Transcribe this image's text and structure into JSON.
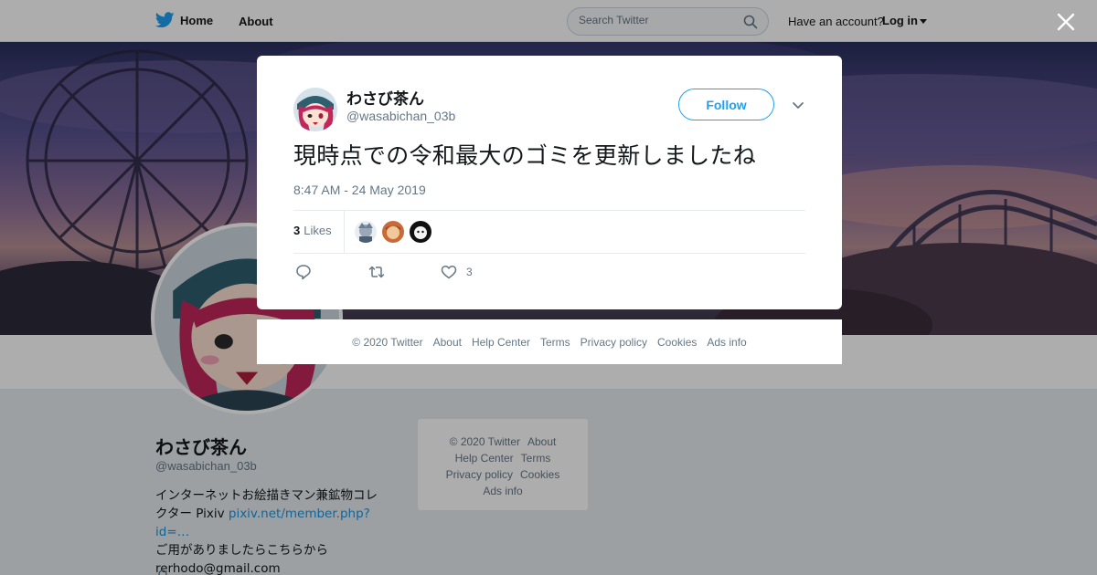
{
  "nav": {
    "home_label": "Home",
    "about_label": "About",
    "search_placeholder": "Search Twitter",
    "have_account": "Have an account?",
    "login_label": "Log in"
  },
  "profile": {
    "name": "わさび茶ん",
    "handle": "@wasabichan_03b",
    "bio_line1": "インターネットお絵描きマン兼鉱物コレ",
    "bio_line2_prefix": "クター Pixiv ",
    "bio_link": "pixiv.net/member.php?id=…",
    "bio_line3": "ご用がありましたらこちらから",
    "bio_line4": "rerhodo@gmail.com"
  },
  "side_footer": {
    "copyright": "© 2020 Twitter",
    "about": "About",
    "help": "Help Center",
    "terms": "Terms",
    "privacy": "Privacy policy",
    "cookies": "Cookies",
    "ads": "Ads info"
  },
  "tweet": {
    "author_name": "わさび茶ん",
    "author_handle": "@wasabichan_03b",
    "follow_label": "Follow",
    "text": "現時点での令和最大のゴミを更新しましたね",
    "timestamp": "8:47 AM - 24 May 2019",
    "likes_count": "3",
    "likes_label": "Likes",
    "like_action_count": "3"
  },
  "modal_footer": {
    "copyright": "© 2020 Twitter",
    "about": "About",
    "help": "Help Center",
    "terms": "Terms",
    "privacy": "Privacy policy",
    "cookies": "Cookies",
    "ads": "Ads info"
  },
  "colors": {
    "accent": "#1da1f2",
    "link": "#1b95e0",
    "text_secondary": "#657786"
  }
}
